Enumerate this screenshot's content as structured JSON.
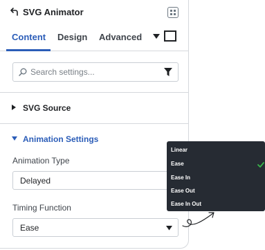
{
  "header": {
    "title": "SVG Animator"
  },
  "tabs": [
    {
      "label": "Content",
      "active": true
    },
    {
      "label": "Design",
      "active": false
    },
    {
      "label": "Advanced",
      "active": false
    }
  ],
  "search": {
    "placeholder": "Search settings..."
  },
  "sections": {
    "svg_source": {
      "label": "SVG Source",
      "expanded": false
    },
    "animation_settings": {
      "label": "Animation Settings",
      "expanded": true
    }
  },
  "fields": {
    "animation_type": {
      "label": "Animation Type",
      "value": "Delayed"
    },
    "timing_function": {
      "label": "Timing Function",
      "value": "Ease"
    }
  },
  "dropdown": {
    "options": [
      "Linear",
      "Ease",
      "Ease In",
      "Ease Out",
      "Ease In Out"
    ],
    "selected": "Ease"
  },
  "colors": {
    "accent": "#2b5db8",
    "dropdown_bg": "#262b33",
    "check": "#39b54a",
    "border": "#d5d8dc"
  }
}
